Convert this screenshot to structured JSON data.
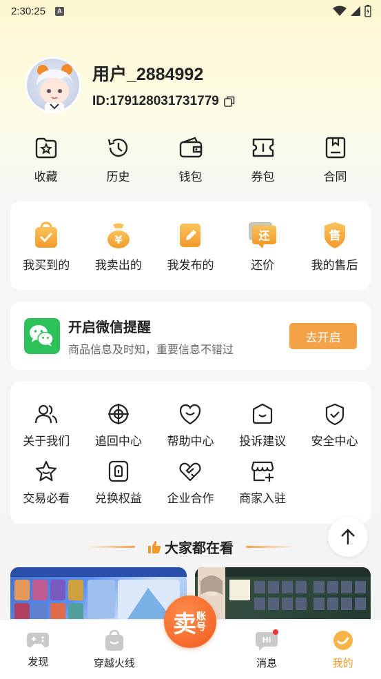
{
  "status": {
    "time": "2:30:25",
    "notif": "A"
  },
  "profile": {
    "username": "用户_2884992",
    "user_id": "ID:179128031731779"
  },
  "quick": [
    {
      "label": "收藏",
      "icon": "favorites-icon"
    },
    {
      "label": "历史",
      "icon": "history-icon"
    },
    {
      "label": "钱包",
      "icon": "wallet-icon"
    },
    {
      "label": "券包",
      "icon": "coupon-icon"
    },
    {
      "label": "合同",
      "icon": "contract-icon"
    }
  ],
  "orders": [
    {
      "label": "我买到的",
      "icon": "bought-icon"
    },
    {
      "label": "我卖出的",
      "icon": "sold-icon"
    },
    {
      "label": "我发布的",
      "icon": "published-icon"
    },
    {
      "label": "还价",
      "icon": "counter-offer-icon",
      "badge_text": "还"
    },
    {
      "label": "我的售后",
      "icon": "after-sales-icon",
      "badge_text": "售"
    }
  ],
  "wechat": {
    "title": "开启微信提醒",
    "subtitle": "商品信息及时知，重要信息不错过",
    "button": "去开启"
  },
  "services": [
    {
      "label": "关于我们",
      "icon": "about-us-icon"
    },
    {
      "label": "追回中心",
      "icon": "recovery-center-icon"
    },
    {
      "label": "帮助中心",
      "icon": "help-center-icon"
    },
    {
      "label": "投诉建议",
      "icon": "complaint-icon"
    },
    {
      "label": "安全中心",
      "icon": "security-center-icon"
    },
    {
      "label": "交易必看",
      "icon": "trade-guide-icon"
    },
    {
      "label": "兑换权益",
      "icon": "redeem-icon"
    },
    {
      "label": "企业合作",
      "icon": "partnership-icon"
    },
    {
      "label": "商家入驻",
      "icon": "merchant-join-icon"
    }
  ],
  "popular": {
    "title": "大家都在看"
  },
  "tabbar": {
    "tabs": [
      {
        "label": "发现",
        "icon": "gamepad-icon"
      },
      {
        "label": "穿越火线",
        "icon": "bag-icon"
      },
      {
        "label": "",
        "icon": "sell-account-icon"
      },
      {
        "label": "消息",
        "icon": "message-icon"
      },
      {
        "label": "我的",
        "icon": "me-icon",
        "active": true
      }
    ],
    "center": {
      "big": "卖",
      "small": "账号"
    }
  },
  "colors": {
    "accent": "#f39a2c",
    "wechat_green": "#2dc15a",
    "button_orange": "#f4a248"
  }
}
